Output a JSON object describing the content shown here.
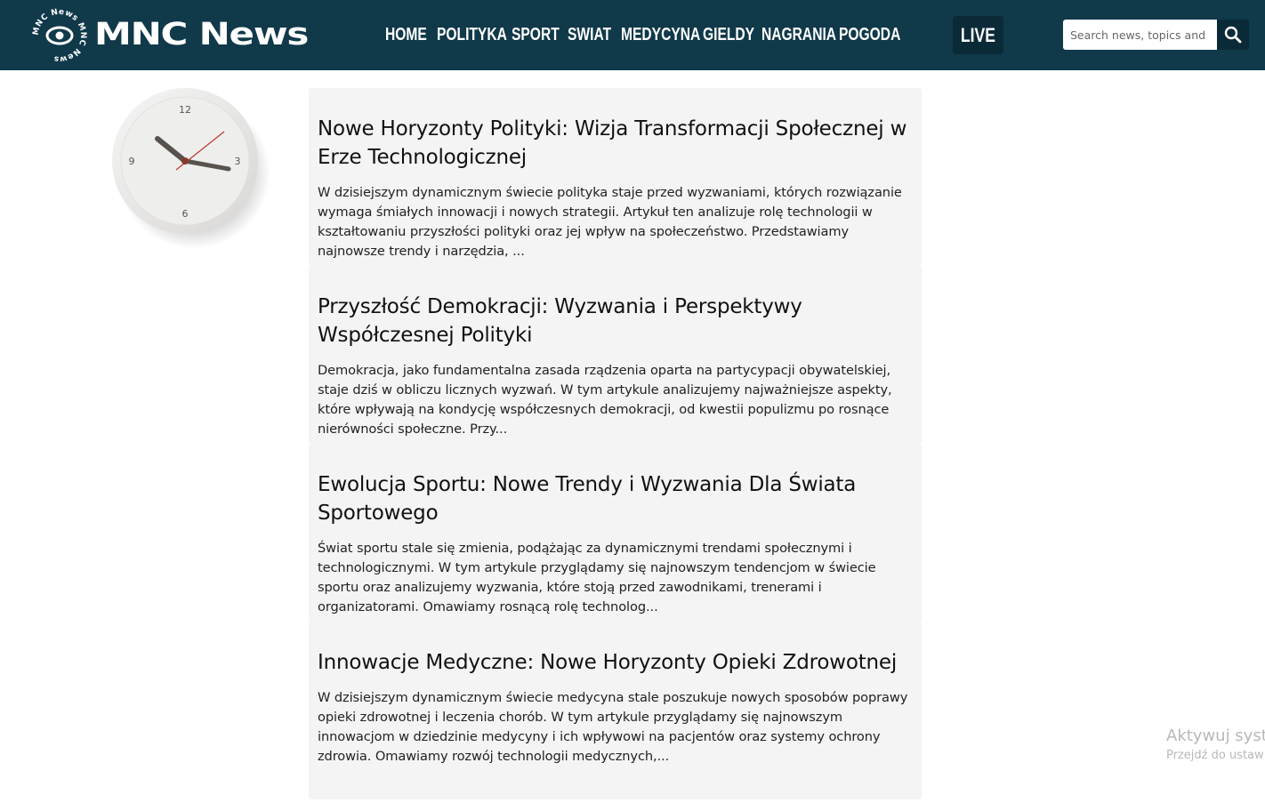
{
  "header": {
    "logo_text": "MNC News",
    "logo_ring_text": "MNC News MNC News",
    "nav": [
      "HOME",
      "POLITYKA",
      "SPORT",
      "SWIAT",
      "MEDYCYNA",
      "GIELDY",
      "NAGRANIA",
      "POGODA"
    ],
    "live_label": "LIVE",
    "search_placeholder": "Search news, topics and m",
    "colors": {
      "bar": "#10394a",
      "button": "#0b2a37"
    }
  },
  "clock": {
    "numbers": [
      "12",
      "3",
      "6",
      "9"
    ]
  },
  "articles": [
    {
      "title": "Nowe Horyzonty Polityki: Wizja Transformacji Społecznej w Erze Technologicznej",
      "excerpt": "W dzisiejszym dynamicznym świecie polityka staje przed wyzwaniami, których rozwiązanie wymaga śmiałych innowacji i nowych strategii. Artykuł ten analizuje rolę technologii w kształtowaniu przyszłości polityki oraz jej wpływ na społeczeństwo. Przedstawiamy najnowsze trendy i narzędzia, ..."
    },
    {
      "title": "Przyszłość Demokracji: Wyzwania i Perspektywy Współczesnej Polityki",
      "excerpt": "Demokracja, jako fundamentalna zasada rządzenia oparta na partycypacji obywatelskiej, staje dziś w obliczu licznych wyzwań. W tym artykule analizujemy najważniejsze aspekty, które wpływają na kondycję współczesnych demokracji, od kwestii populizmu po rosnące nierówności społeczne. Przy..."
    },
    {
      "title": "Ewolucja Sportu: Nowe Trendy i Wyzwania Dla Świata Sportowego",
      "excerpt": "Świat sportu stale się zmienia, podążając za dynamicznymi trendami społecznymi i technologicznymi. W tym artykule przyglądamy się najnowszym tendencjom w świecie sportu oraz analizujemy wyzwania, które stoją przed zawodnikami, trenerami i organizatorami. Omawiamy rosnącą rolę technolog..."
    },
    {
      "title": "Innowacje Medyczne: Nowe Horyzonty Opieki Zdrowotnej",
      "excerpt": "W dzisiejszym dynamicznym świecie medycyna stale poszukuje nowych sposobów poprawy opieki zdrowotnej i leczenia chorób. W tym artykule przyglądamy się najnowszym innowacjom w dziedzinie medycyny i ich wpływowi na pacjentów oraz systemy ochrony zdrowia. Omawiamy rozwój technologii medycznych,..."
    }
  ],
  "watermark": {
    "line1": "Aktywuj syste",
    "line2": "Przejdź do ustaw"
  }
}
